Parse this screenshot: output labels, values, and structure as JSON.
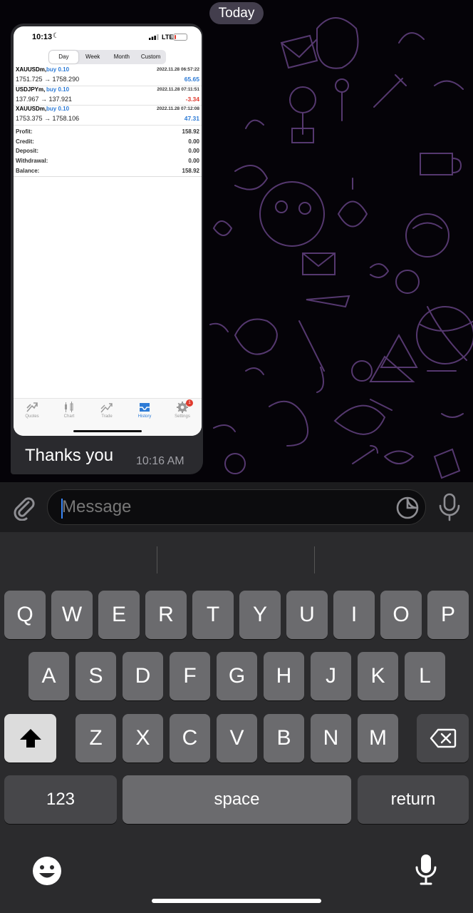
{
  "chat": {
    "date_label": "Today",
    "message": {
      "text": "Thanks you",
      "time": "10:16 AM"
    }
  },
  "screenshot": {
    "status": {
      "time": "10:13",
      "network": "LTE",
      "battery_level": 0.15
    },
    "segments": [
      "Day",
      "Week",
      "Month",
      "Custom"
    ],
    "active_segment": "Day",
    "trades": [
      {
        "symbol": "XAUUSDm,",
        "direction": "buy 0.10",
        "date": "2022.11.28 06:57:22",
        "prices": "1751.725 → 1758.290",
        "profit": "65.65",
        "profit_color": "#2d7bd6"
      },
      {
        "symbol": "USDJPYm,",
        "direction": "buy 0.10",
        "date": "2022.11.28 07:11:51",
        "prices": "137.967 → 137.921",
        "profit": "-3.34",
        "profit_color": "#e03b2e"
      },
      {
        "symbol": "XAUUSDm,",
        "direction": "buy 0.10",
        "date": "2022.11.28 07:12:08",
        "prices": "1753.375 → 1758.106",
        "profit": "47.31",
        "profit_color": "#2d7bd6"
      }
    ],
    "summary": [
      {
        "label": "Profit:",
        "value": "158.92"
      },
      {
        "label": "Credit:",
        "value": "0.00"
      },
      {
        "label": "Deposit:",
        "value": "0.00"
      },
      {
        "label": "Withdrawal:",
        "value": "0.00"
      },
      {
        "label": "Balance:",
        "value": "158.92"
      }
    ],
    "tabs": [
      {
        "label": "Quotes",
        "icon": "quotes-icon"
      },
      {
        "label": "Chart",
        "icon": "chart-icon"
      },
      {
        "label": "Trade",
        "icon": "trade-icon"
      },
      {
        "label": "History",
        "icon": "history-icon",
        "active": true
      },
      {
        "label": "Settings",
        "icon": "settings-icon",
        "badge": "1"
      }
    ]
  },
  "input": {
    "placeholder": "Message"
  },
  "keyboard": {
    "row1": [
      "Q",
      "W",
      "E",
      "R",
      "T",
      "Y",
      "U",
      "I",
      "O",
      "P"
    ],
    "row2": [
      "A",
      "S",
      "D",
      "F",
      "G",
      "H",
      "J",
      "K",
      "L"
    ],
    "row3": [
      "Z",
      "X",
      "C",
      "V",
      "B",
      "N",
      "M"
    ],
    "numbers_label": "123",
    "space_label": "space",
    "return_label": "return"
  },
  "colors": {
    "accent": "#2d7bd6",
    "loss": "#e03b2e",
    "doodle": "#5a3a78",
    "caret": "#3a86f7"
  }
}
